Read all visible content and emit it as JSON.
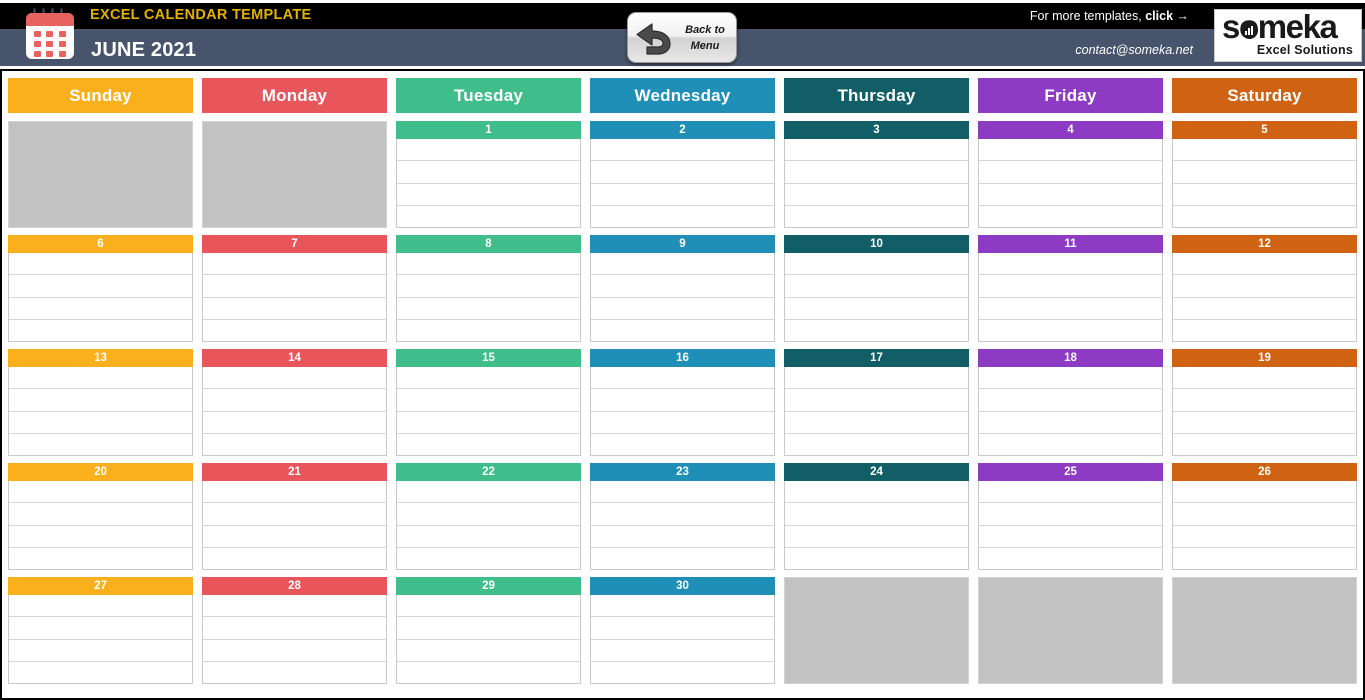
{
  "header": {
    "template_title": "EXCEL CALENDAR TEMPLATE",
    "month_title": "JUNE 2021",
    "calendar_icon": "calendar-icon",
    "back_button": {
      "line1": "Back to",
      "line2": "Menu",
      "icon": "back-arrow-icon"
    },
    "more_templates_prefix": "For more templates, ",
    "more_templates_link": "click →",
    "contact_email": "contact@someka.net",
    "logo": {
      "word": "someka",
      "subtitle": "Excel Solutions",
      "icon": "bar-chart-icon"
    },
    "colors": {
      "black_bar": "#000000",
      "slate_bar": "#47546b",
      "title_gold": "#e3b100"
    }
  },
  "calendar": {
    "days": [
      {
        "label": "Sunday",
        "color": "#f9b01c"
      },
      {
        "label": "Monday",
        "color": "#e8565c"
      },
      {
        "label": "Tuesday",
        "color": "#3fbd8a"
      },
      {
        "label": "Wednesday",
        "color": "#1f8fb8"
      },
      {
        "label": "Thursday",
        "color": "#115e67"
      },
      {
        "label": "Friday",
        "color": "#8e3bc4"
      },
      {
        "label": "Saturday",
        "color": "#cf6213"
      }
    ],
    "blank_color": "#c2c2c2",
    "lines_per_cell": 4,
    "weeks": [
      [
        null,
        null,
        "1",
        "2",
        "3",
        "4",
        "5"
      ],
      [
        "6",
        "7",
        "8",
        "9",
        "10",
        "11",
        "12"
      ],
      [
        "13",
        "14",
        "15",
        "16",
        "17",
        "18",
        "19"
      ],
      [
        "20",
        "21",
        "22",
        "23",
        "24",
        "25",
        "26"
      ],
      [
        "27",
        "28",
        "29",
        "30",
        null,
        null,
        null
      ]
    ]
  }
}
